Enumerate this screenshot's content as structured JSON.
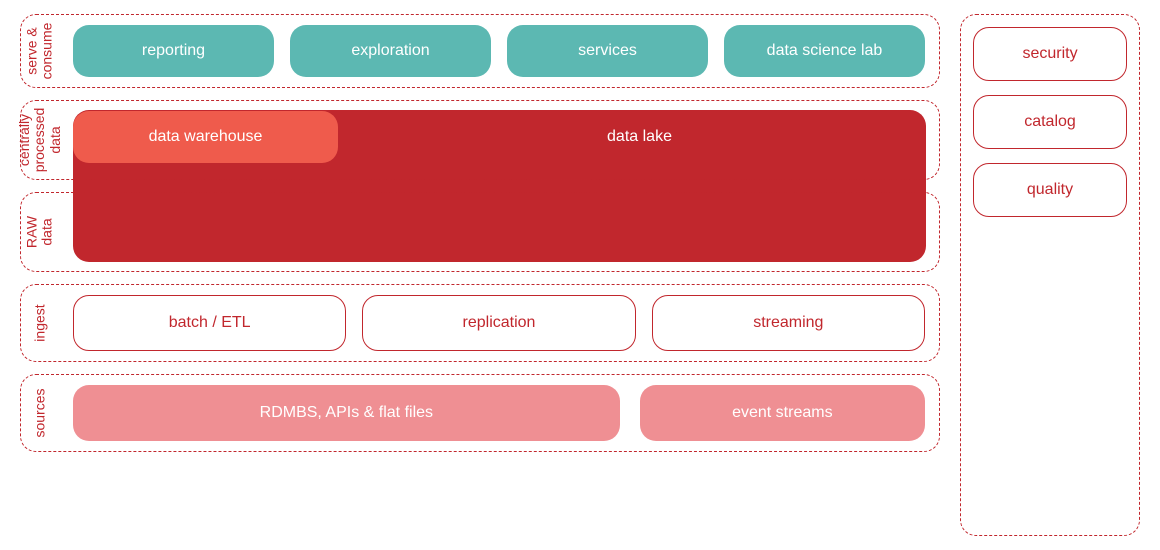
{
  "lanes": {
    "serve": {
      "label": "serve &\nconsume",
      "items": [
        "reporting",
        "exploration",
        "services",
        "data science lab"
      ]
    },
    "central": {
      "label": "centrally\nprocessed\ndata",
      "warehouse": "data warehouse",
      "lake": "data lake"
    },
    "raw": {
      "label": "RAW\ndata"
    },
    "ingest": {
      "label": "ingest",
      "items": [
        "batch / ETL",
        "replication",
        "streaming"
      ]
    },
    "sources": {
      "label": "sources",
      "items": [
        "RDMBS, APIs & flat files",
        "event streams"
      ]
    }
  },
  "side": [
    "security",
    "catalog",
    "quality"
  ],
  "colors": {
    "teal": "#5cb8b2",
    "coral": "#ef5b4c",
    "deepred": "#c1272d",
    "pink": "#ef8f93"
  }
}
